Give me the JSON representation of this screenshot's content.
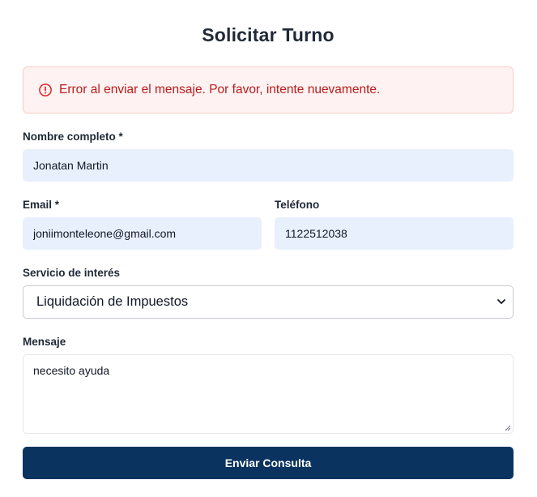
{
  "form": {
    "title": "Solicitar Turno",
    "alert": {
      "icon": "alert-circle-icon",
      "message": "Error al enviar el mensaje. Por favor, intente nuevamente.",
      "color": "#b91c1c"
    },
    "fields": {
      "name": {
        "label": "Nombre completo *",
        "value": "Jonatan Martin"
      },
      "email": {
        "label": "Email *",
        "value": "joniimonteleone@gmail.com"
      },
      "phone": {
        "label": "Teléfono",
        "value": "1122512038"
      },
      "service": {
        "label": "Servicio de interés",
        "value": "Liquidación de Impuestos"
      },
      "message": {
        "label": "Mensaje",
        "value": "necesito ayuda"
      }
    },
    "submit_label": "Enviar Consulta",
    "colors": {
      "accent": "#0b3360",
      "autofill": "#e8f0fe",
      "alert_bg": "#fef2f2"
    }
  }
}
